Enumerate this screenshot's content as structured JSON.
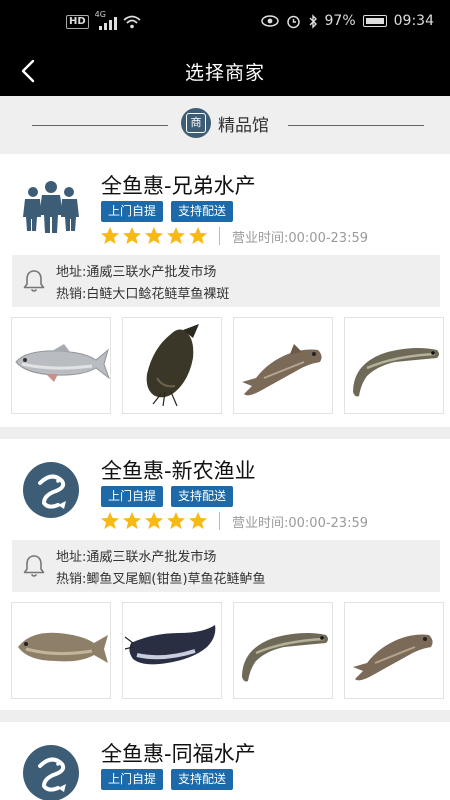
{
  "status": {
    "network_label": "HD",
    "net_type": "4G",
    "battery": "97%",
    "time": "09:34"
  },
  "nav": {
    "title": "选择商家"
  },
  "section": {
    "badge_char": "商",
    "title": "精品馆"
  },
  "shops": [
    {
      "name": "全鱼惠-兄弟水产",
      "logo": "people-group-icon",
      "tags": [
        "上门自提",
        "支持配送"
      ],
      "stars": 5,
      "hours": "营业时间:00:00-23:59",
      "address": "地址:通威三联水产批发市场",
      "hot": "热销:白鲢大口鲶花鲢草鱼裸斑",
      "thumbs": [
        "silver-carp-image",
        "catfish-image",
        "bighead-carp-image",
        "grass-carp-image"
      ]
    },
    {
      "name": "全鱼惠-新农渔业",
      "logo": "fish-circle-logo-icon",
      "tags": [
        "上门自提",
        "支持配送"
      ],
      "stars": 5,
      "hours": "营业时间:00:00-23:59",
      "address": "地址:通威三联水产批发市场",
      "hot": "热销:鲫鱼叉尾鮰(钳鱼)草鱼花鲢鲈鱼",
      "thumbs": [
        "crucian-carp-image",
        "channel-catfish-image",
        "grass-carp-image",
        "bighead-carp-image"
      ]
    },
    {
      "name": "全鱼惠-同福水产",
      "logo": "fish-circle-logo-icon",
      "tags": [
        "上门自提",
        "支持配送"
      ]
    }
  ],
  "colors": {
    "tag_blue": "#1e6aa8",
    "star_yellow": "#f7b916",
    "logo_slate": "#3d5d76"
  }
}
